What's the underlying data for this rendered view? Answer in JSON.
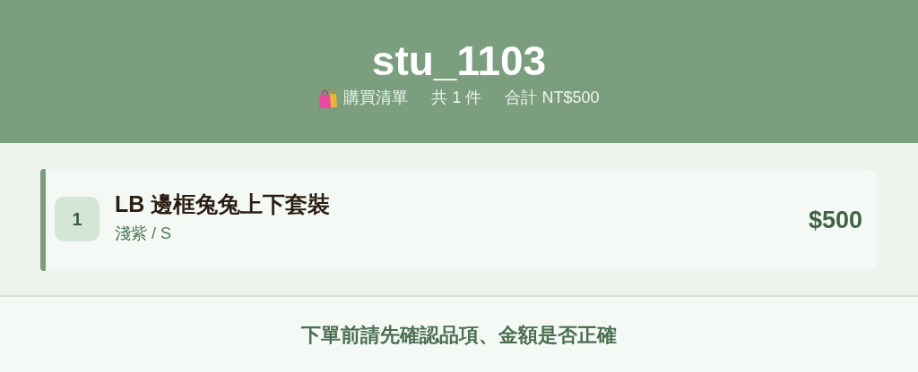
{
  "header": {
    "title": "stu_1103",
    "list_label": "購買清單",
    "count": "共 1 件",
    "total": "合計 NT$500"
  },
  "items": [
    {
      "index": "1",
      "name": "LB 邊框兔兔上下套裝",
      "variant": "淺紫 / S",
      "price": "$500"
    }
  ],
  "footer": {
    "note": "下單前請先確認品項、金額是否正確"
  }
}
